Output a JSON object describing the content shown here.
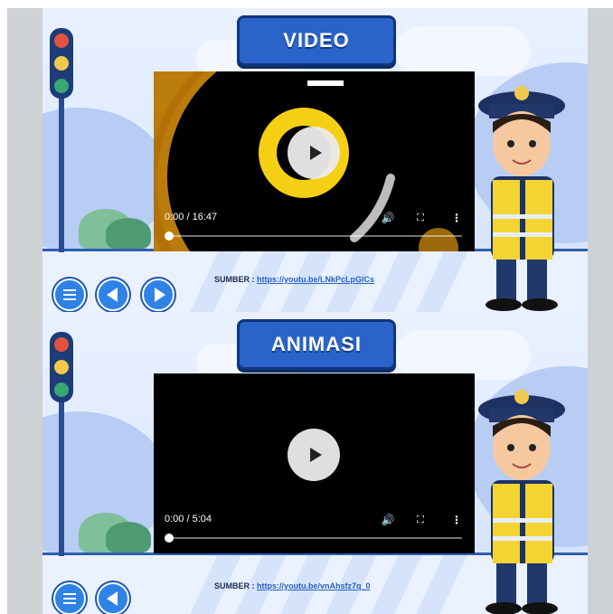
{
  "slides": [
    {
      "title": "VIDEO",
      "player": {
        "time": "0:00 / 16:47"
      },
      "source_label": "SUMBER :",
      "source_link": "https://youtu.be/LNkPcLpGlCs"
    },
    {
      "title": "ANIMASI",
      "player": {
        "time": "0:00 / 5:04"
      },
      "source_label": "SUMBER :",
      "source_link": "https://youtu.be/vnAhsfz7q_0"
    }
  ],
  "icons": {
    "play": "play-icon",
    "volume": "volume-icon",
    "fullscreen": "fullscreen-icon",
    "more": "more-vertical-icon",
    "menu": "menu-list-icon",
    "prev": "arrow-left-icon",
    "next": "arrow-right-icon"
  },
  "colors": {
    "accent": "#2a63c9",
    "background": "#dfeaff",
    "police_vest": "#f2d433",
    "link": "#2563c4"
  }
}
